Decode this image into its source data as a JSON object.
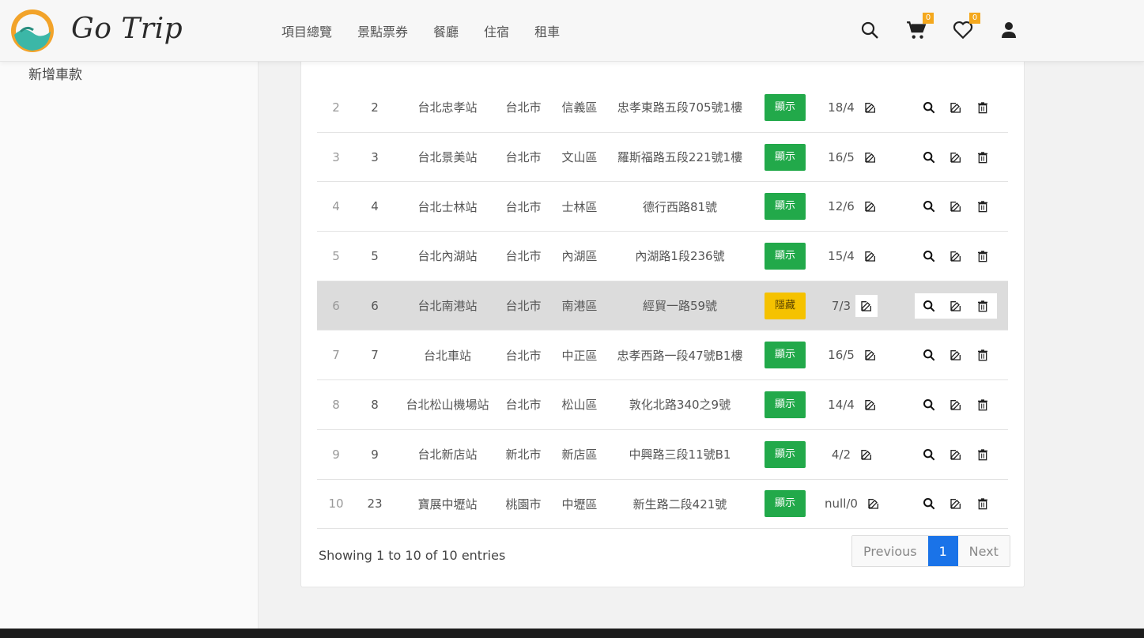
{
  "header": {
    "brand": "Go Trip",
    "nav": [
      "項目總覽",
      "景點票券",
      "餐廳",
      "住宿",
      "租車"
    ],
    "cart_count": "0",
    "wishlist_count": "0"
  },
  "sidebar": {
    "items": [
      "新增車款"
    ]
  },
  "table": {
    "rows": [
      {
        "idx": "2",
        "id": "2",
        "name": "台北忠孝站",
        "city": "台北市",
        "district": "信義區",
        "address": "忠孝東路五段705號1樓",
        "status": "顯示",
        "count": "18/4"
      },
      {
        "idx": "3",
        "id": "3",
        "name": "台北景美站",
        "city": "台北市",
        "district": "文山區",
        "address": "羅斯福路五段221號1樓",
        "status": "顯示",
        "count": "16/5"
      },
      {
        "idx": "4",
        "id": "4",
        "name": "台北士林站",
        "city": "台北市",
        "district": "士林區",
        "address": "德行西路81號",
        "status": "顯示",
        "count": "12/6"
      },
      {
        "idx": "5",
        "id": "5",
        "name": "台北內湖站",
        "city": "台北市",
        "district": "內湖區",
        "address": "內湖路1段236號",
        "status": "顯示",
        "count": "15/4"
      },
      {
        "idx": "6",
        "id": "6",
        "name": "台北南港站",
        "city": "台北市",
        "district": "南港區",
        "address": "經貿一路59號",
        "status": "隱藏",
        "count": "7/3"
      },
      {
        "idx": "7",
        "id": "7",
        "name": "台北車站",
        "city": "台北市",
        "district": "中正區",
        "address": "忠孝西路一段47號B1樓",
        "status": "顯示",
        "count": "16/5"
      },
      {
        "idx": "8",
        "id": "8",
        "name": "台北松山機場站",
        "city": "台北市",
        "district": "松山區",
        "address": "敦化北路340之9號",
        "status": "顯示",
        "count": "14/4"
      },
      {
        "idx": "9",
        "id": "9",
        "name": "台北新店站",
        "city": "新北市",
        "district": "新店區",
        "address": "中興路三段11號B1",
        "status": "顯示",
        "count": "4/2"
      },
      {
        "idx": "10",
        "id": "23",
        "name": "寶展中壢站",
        "city": "桃園市",
        "district": "中壢區",
        "address": "新生路二段421號",
        "status": "顯示",
        "count": "null/0"
      }
    ],
    "highlight_row": 4
  },
  "footer": {
    "info": "Showing 1 to 10 of 10 entries",
    "previous": "Previous",
    "page": "1",
    "next": "Next"
  },
  "colors": {
    "status_show": "#22a94a",
    "status_hide": "#f5c200",
    "active_page": "#1a73e8"
  }
}
